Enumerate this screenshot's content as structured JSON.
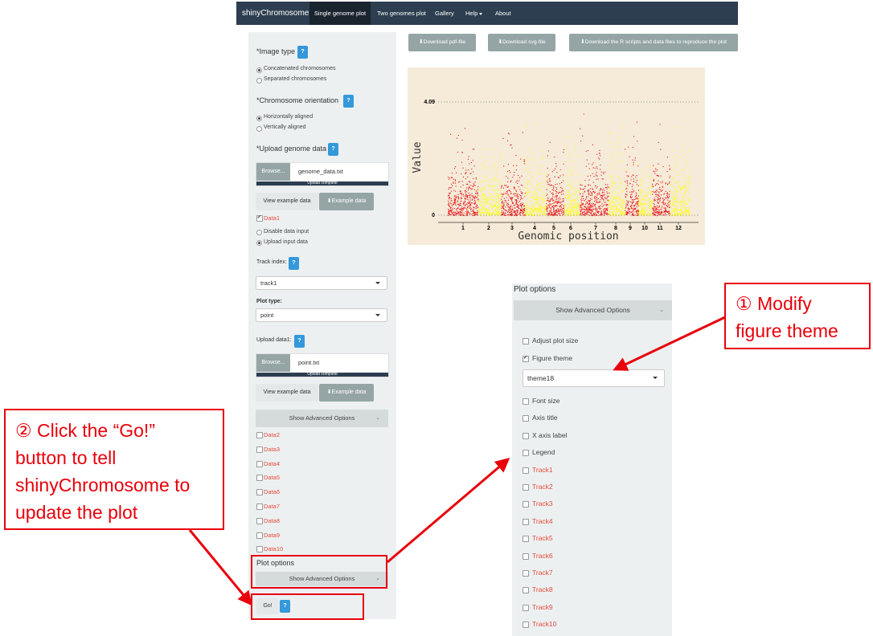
{
  "navbar": {
    "brand": "shinyChromosome",
    "items": [
      "Single genome plot",
      "Two genomes plot",
      "Gallery",
      "Help",
      "About"
    ]
  },
  "sidebar": {
    "image_type_label": "*Image type",
    "image_type_options": [
      "Concatenated chromosomes",
      "Separated chromosomes"
    ],
    "orientation_label": "*Chromosome orientation",
    "orientation_options": [
      "Horizontally aligned",
      "Vertically aligned"
    ],
    "upload_genome_label": "*Upload genome data",
    "help_glyph": "?",
    "browse_label": "Browse...",
    "genome_file": "genome_data.txt",
    "upload_complete": "Upload complete",
    "view_example": "View example data",
    "example_data": "Example data",
    "data1_label": "Data1",
    "data_input_options": [
      "Disable data input",
      "Upload input data"
    ],
    "track_index_label": "Track index:",
    "track_index_value": "track1",
    "plot_type_label": "Plot type:",
    "plot_type_value": "point",
    "upload_data1_label": "Upload data1:",
    "data1_file": "point.txt",
    "advanced_label": "Show Advanced Options",
    "data_items": [
      "Data2",
      "Data3",
      "Data4",
      "Data5",
      "Data6",
      "Data7",
      "Data8",
      "Data9",
      "Data10"
    ],
    "plot_options_label": "Plot options",
    "go_label": "Go!"
  },
  "downloads": {
    "pdf": "Download pdf-file",
    "svg": "Download svg-file",
    "scripts": "Download the R scripts and data files to reproduce the plot"
  },
  "chart_data": {
    "type": "scatter",
    "xlabel": "Genomic position",
    "ylabel": "Value",
    "ylim": [
      0,
      4.09
    ],
    "y_ticks": [
      "4.09",
      "0"
    ],
    "categories": [
      "1",
      "2",
      "3",
      "4",
      "5",
      "6",
      "7",
      "8",
      "9",
      "10",
      "11",
      "12"
    ],
    "colors": [
      "#e8141a",
      "#ffff1a"
    ],
    "background": "#f5ebd8"
  },
  "plot_options_panel": {
    "title": "Plot options",
    "advanced_label": "Show Advanced Options",
    "options": [
      {
        "label": "Adjust plot size",
        "checked": false,
        "red": false
      },
      {
        "label": "Figure theme",
        "checked": true,
        "red": false
      }
    ],
    "theme_value": "theme18",
    "more_options": [
      {
        "label": "Font size",
        "red": false
      },
      {
        "label": "Axis title",
        "red": false
      },
      {
        "label": "X axis label",
        "red": false
      },
      {
        "label": "Legend",
        "red": false
      },
      {
        "label": "Track1",
        "red": true
      },
      {
        "label": "Track2",
        "red": true
      },
      {
        "label": "Track3",
        "red": true
      },
      {
        "label": "Track4",
        "red": true
      },
      {
        "label": "Track5",
        "red": true
      },
      {
        "label": "Track6",
        "red": true
      },
      {
        "label": "Track7",
        "red": true
      },
      {
        "label": "Track8",
        "red": true
      },
      {
        "label": "Track9",
        "red": true
      },
      {
        "label": "Track10",
        "red": true
      }
    ]
  },
  "annotations": {
    "step1_line1": "① Modify",
    "step1_line2": "figure theme",
    "step2_lines": [
      "② Click the “Go!”",
      "button to tell",
      "shinyChromosome to",
      "update the plot"
    ]
  }
}
